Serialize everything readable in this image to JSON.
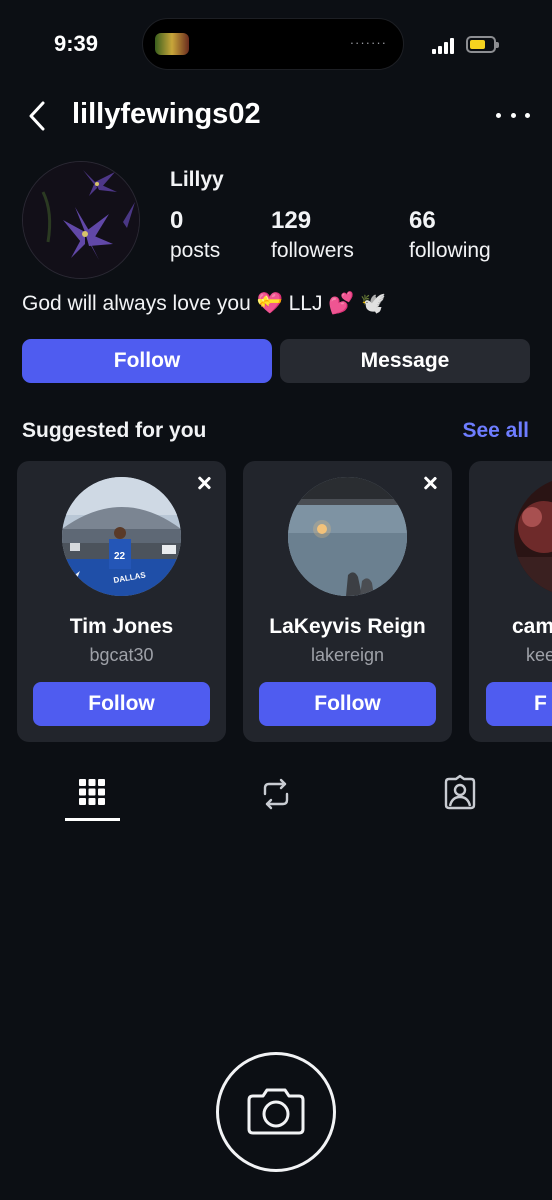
{
  "status_bar": {
    "time": "9:39",
    "island_dots": "·······",
    "battery_color": "#f5d31f"
  },
  "header": {
    "username": "lillyfewings02",
    "back_icon": "chevron-left-icon",
    "more_icon": "more-horizontal-icon"
  },
  "profile": {
    "display_name": "Lillyy",
    "stats": [
      {
        "value": "0",
        "label": "posts"
      },
      {
        "value": "129",
        "label": "followers"
      },
      {
        "value": "66",
        "label": "following"
      }
    ],
    "bio": "God will always love you 💝  LLJ  💕 🕊️",
    "follow_label": "Follow",
    "message_label": "Message"
  },
  "suggested": {
    "title": "Suggested for you",
    "see_all": "See all",
    "cards": [
      {
        "name": "Tim Jones",
        "handle": "bgcat30",
        "follow_label": "Follow"
      },
      {
        "name": "LaKeyvis Reign",
        "handle": "lakereign",
        "follow_label": "Follow"
      },
      {
        "name": "cam",
        "handle": "kee",
        "follow_label": "F"
      }
    ]
  },
  "tabs": [
    {
      "name": "grid-tab",
      "icon": "grid-icon",
      "active": true
    },
    {
      "name": "reposts-tab",
      "icon": "repost-icon",
      "active": false
    },
    {
      "name": "tagged-tab",
      "icon": "person-tag-icon",
      "active": false
    }
  ],
  "colors": {
    "background": "#0c0f14",
    "accent": "#4f5cf0",
    "link": "#6e7dff",
    "card": "#22252c"
  }
}
